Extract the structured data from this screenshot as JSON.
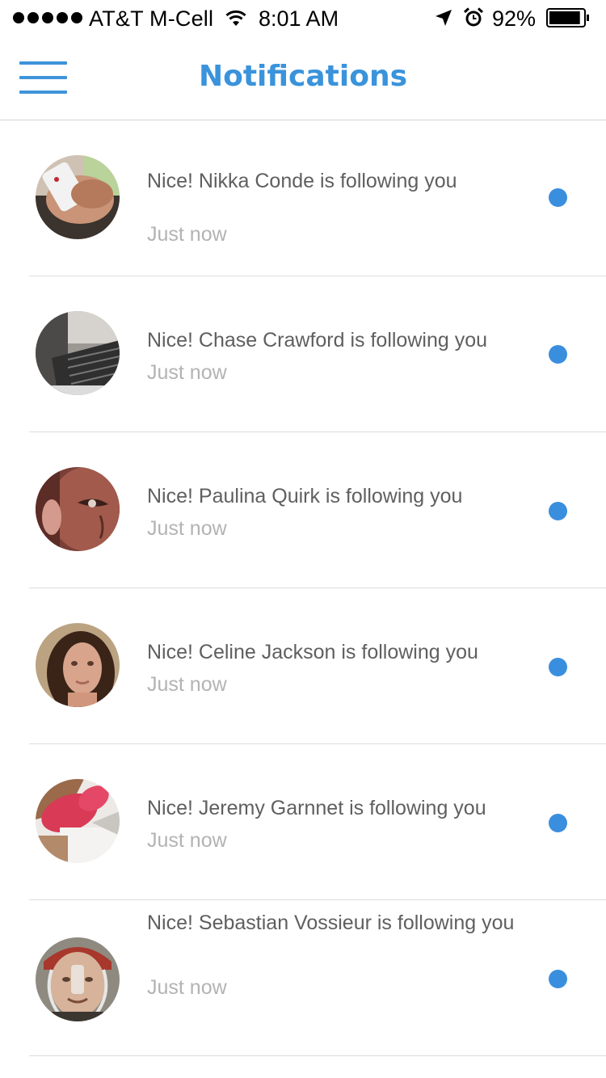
{
  "status_bar": {
    "carrier": "AT&T M-Cell",
    "time": "8:01 AM",
    "battery_percent": "92%",
    "battery_level": 0.92,
    "signal_bars": 5
  },
  "nav": {
    "title": "Notifications",
    "menu_icon": "hamburger-menu-icon"
  },
  "colors": {
    "accent": "#3a93db",
    "unread_dot": "#3a8ede",
    "text": "#5f5f5f",
    "muted": "#b3b3b3"
  },
  "notifications": [
    {
      "text": "Nice! Nikka Conde  is following you",
      "time": "Just now",
      "unread": true
    },
    {
      "text": "Nice! Chase Crawford is following you",
      "time": "Just now",
      "unread": true
    },
    {
      "text": "Nice! Paulina Quirk is following you",
      "time": "Just now",
      "unread": true
    },
    {
      "text": "Nice! Celine Jackson is following you",
      "time": "Just now",
      "unread": true
    },
    {
      "text": "Nice! Jeremy Garnnet is following you",
      "time": "Just now",
      "unread": true
    },
    {
      "text": "Nice! Sebastian Vossieur is following you",
      "time": "Just now",
      "unread": true
    }
  ]
}
